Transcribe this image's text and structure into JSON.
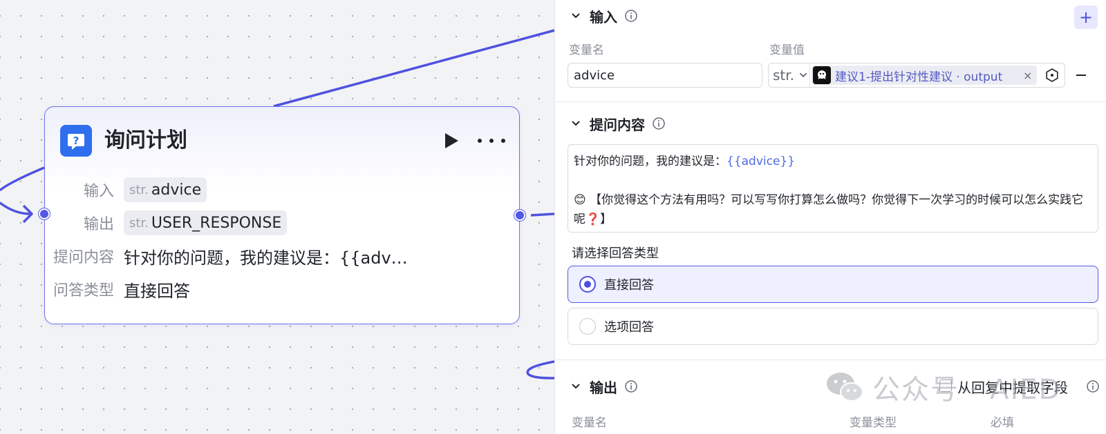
{
  "node": {
    "title": "询问计划",
    "rows": [
      {
        "label": "输入",
        "type": "str.",
        "value": "advice"
      },
      {
        "label": "输出",
        "type": "str.",
        "value": "USER_RESPONSE"
      }
    ],
    "prompt_label": "提问内容",
    "prompt_value": "针对你的问题，我的建议是：{{adv…",
    "answer_type_label": "问答类型",
    "answer_type_value": "直接回答"
  },
  "panel": {
    "input_section": {
      "title": "输入",
      "col_name": "变量名",
      "col_value": "变量值",
      "add_label": "+",
      "var_name_value": "advice",
      "type_value": "str.",
      "ref_text": "建议1-提出针对性建议 · output",
      "ref_close": "×"
    },
    "prompt_section": {
      "title": "提问内容",
      "line1_prefix": "针对你的问题，我的建议是：",
      "line1_var": "{{advice}}",
      "line2_emoji": "😊",
      "line2_text": "【你觉得这个方法有用吗？可以写写你打算怎么做吗？你觉得下一次学习的时候可以怎么实践它呢❓】"
    },
    "answer_type": {
      "title": "请选择回答类型",
      "options": [
        {
          "label": "直接回答",
          "selected": true
        },
        {
          "label": "选项回答",
          "selected": false
        }
      ]
    },
    "output_section": {
      "title": "输出",
      "extract_label": "从回复中提取字段",
      "col_name": "变量名",
      "col_type": "变量类型",
      "col_required": "必填"
    }
  },
  "watermark": {
    "text": "公众号 · AIED"
  },
  "colors": {
    "accent": "#5458e6",
    "edge": "#4f52e0",
    "node_icon": "#2f6fef"
  }
}
